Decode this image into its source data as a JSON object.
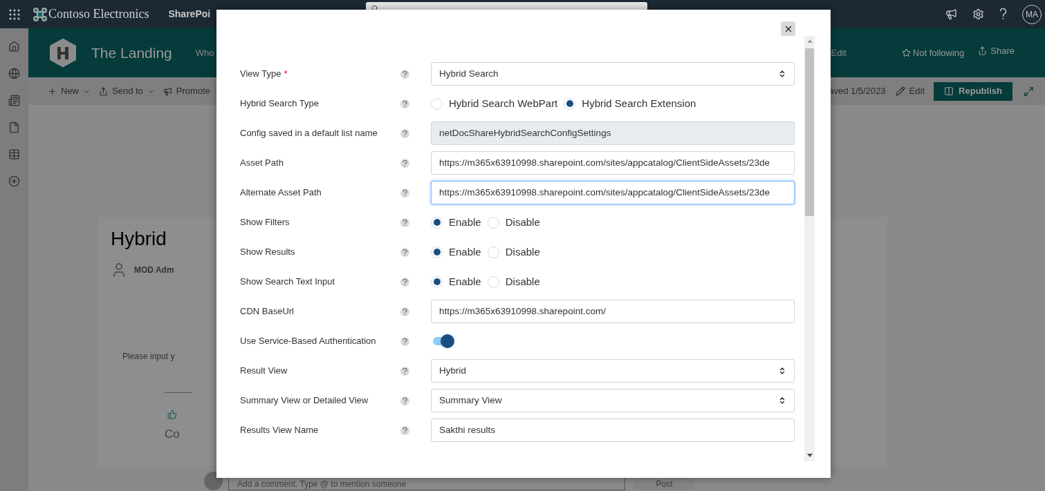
{
  "suite_bar": {
    "app_name": "Contoso Electronics",
    "product": "SharePoi",
    "avatar": "MA"
  },
  "site_header": {
    "title": "The Landing",
    "nav": "Who",
    "edit_link": "Edit",
    "follow": "Not following",
    "share": "Share"
  },
  "command_bar": {
    "items": [
      {
        "label": "New",
        "kind": "add",
        "dropdown": true
      },
      {
        "label": "Send to",
        "kind": "send",
        "dropdown": true
      },
      {
        "label": "Promote",
        "kind": "promote",
        "dropdown": false
      }
    ],
    "saved": "aved 1/5/2023",
    "edit": "Edit",
    "republish": "Republish"
  },
  "page": {
    "title": "Hybrid",
    "author": "MOD Adm",
    "prompt": "Please input y",
    "comments_heading": "Co",
    "comment_placeholder": "Add a comment. Type @ to mention someone",
    "post": "Post"
  },
  "dialog": {
    "required_mark": "*",
    "fields": [
      {
        "kind": "select",
        "label": "View Type",
        "required": true,
        "value": "Hybrid Search"
      },
      {
        "kind": "radio",
        "label": "Hybrid Search Type",
        "required": false,
        "options": [
          {
            "label": "Hybrid Search WebPart",
            "selected": false
          },
          {
            "label": "Hybrid Search Extension",
            "selected": true
          }
        ]
      },
      {
        "kind": "readonly",
        "label": "Config saved in a default list name",
        "required": false,
        "value": "netDocShareHybridSearchConfigSettings"
      },
      {
        "kind": "text",
        "label": "Asset Path",
        "required": false,
        "focused": false,
        "value": "https://m365x63910998.sharepoint.com/sites/appcatalog/ClientSideAssets/23de"
      },
      {
        "kind": "text",
        "label": "Alternate Asset Path",
        "required": false,
        "focused": true,
        "value": "https://m365x63910998.sharepoint.com/sites/appcatalog/ClientSideAssets/23de"
      },
      {
        "kind": "radio",
        "label": "Show Filters",
        "required": false,
        "options": [
          {
            "label": "Enable",
            "selected": true
          },
          {
            "label": "Disable",
            "selected": false
          }
        ]
      },
      {
        "kind": "radio",
        "label": "Show Results",
        "required": false,
        "options": [
          {
            "label": "Enable",
            "selected": true
          },
          {
            "label": "Disable",
            "selected": false
          }
        ]
      },
      {
        "kind": "radio",
        "label": "Show Search Text Input",
        "required": false,
        "options": [
          {
            "label": "Enable",
            "selected": true
          },
          {
            "label": "Disable",
            "selected": false
          }
        ]
      },
      {
        "kind": "text",
        "label": "CDN BaseUrl",
        "required": false,
        "focused": false,
        "value": "https://m365x63910998.sharepoint.com/"
      },
      {
        "kind": "toggle",
        "label": "Use Service-Based Authentication",
        "required": false,
        "on": true
      },
      {
        "kind": "select",
        "label": "Result View",
        "required": false,
        "value": "Hybrid"
      },
      {
        "kind": "select",
        "label": "Summary View or Detailed View",
        "required": false,
        "value": "Summary View"
      },
      {
        "kind": "text",
        "label": "Results View Name",
        "required": false,
        "focused": false,
        "value": "Sakthi results"
      }
    ]
  }
}
